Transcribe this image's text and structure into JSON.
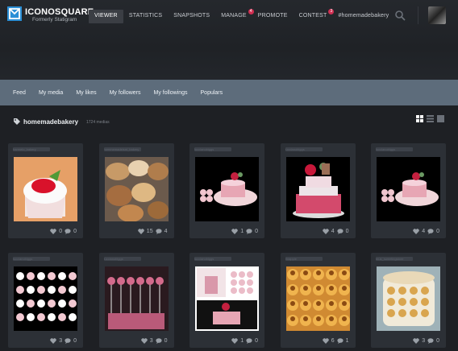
{
  "header": {
    "brand": "ICONOSQUARE",
    "brand_sub": "Formerly Statigram",
    "nav": [
      {
        "label": "VIEWER",
        "active": true,
        "badge": ""
      },
      {
        "label": "STATISTICS",
        "active": false,
        "badge": ""
      },
      {
        "label": "SNAPSHOTS",
        "active": false,
        "badge": ""
      },
      {
        "label": "MANAGE",
        "active": false,
        "badge": "4"
      },
      {
        "label": "PROMOTE",
        "active": false,
        "badge": ""
      },
      {
        "label": "CONTEST",
        "active": false,
        "badge": "3"
      },
      {
        "label": "#homemadebakery",
        "active": false,
        "badge": ""
      }
    ]
  },
  "subnav": [
    "Feed",
    "My media",
    "My likes",
    "My followers",
    "My followings",
    "Populars"
  ],
  "tag": {
    "title": "homemadebakery",
    "count": "1724 medias"
  },
  "colors": {
    "accent": "#2b8fd6",
    "badge": "#d12f52",
    "subnav": "#5d6c7b"
  },
  "cards": [
    {
      "user": "harmelo_bakery",
      "likes": "0",
      "comments": "0",
      "image": "cupcake-strawberry"
    },
    {
      "user": "hommemadeisnt_bakery",
      "likes": "15",
      "comments": "4",
      "image": "cookies-bowls"
    },
    {
      "user": "luccianobiggs",
      "likes": "1",
      "comments": "0",
      "image": "pink-cake-cupcakes"
    },
    {
      "user": "luccianobiggs",
      "likes": "4",
      "comments": "0",
      "image": "pink-ruffle-cake"
    },
    {
      "user": "luccianobiggs",
      "likes": "4",
      "comments": "0",
      "image": "pink-cake-cupcakes"
    },
    {
      "user": "luccianobiggs",
      "likes": "3",
      "comments": "0",
      "image": "cupcakes-grid"
    },
    {
      "user": "luccianobiggs",
      "likes": "3",
      "comments": "0",
      "image": "cake-pops"
    },
    {
      "user": "luccianobiggs",
      "likes": "1",
      "comments": "0",
      "image": "collage-cake"
    },
    {
      "user": "thrapple",
      "likes": "6",
      "comments": "1",
      "image": "pineapple-tarts"
    },
    {
      "user": "mus_sweetingstore",
      "likes": "3",
      "comments": "0",
      "image": "cookie-jar"
    }
  ]
}
